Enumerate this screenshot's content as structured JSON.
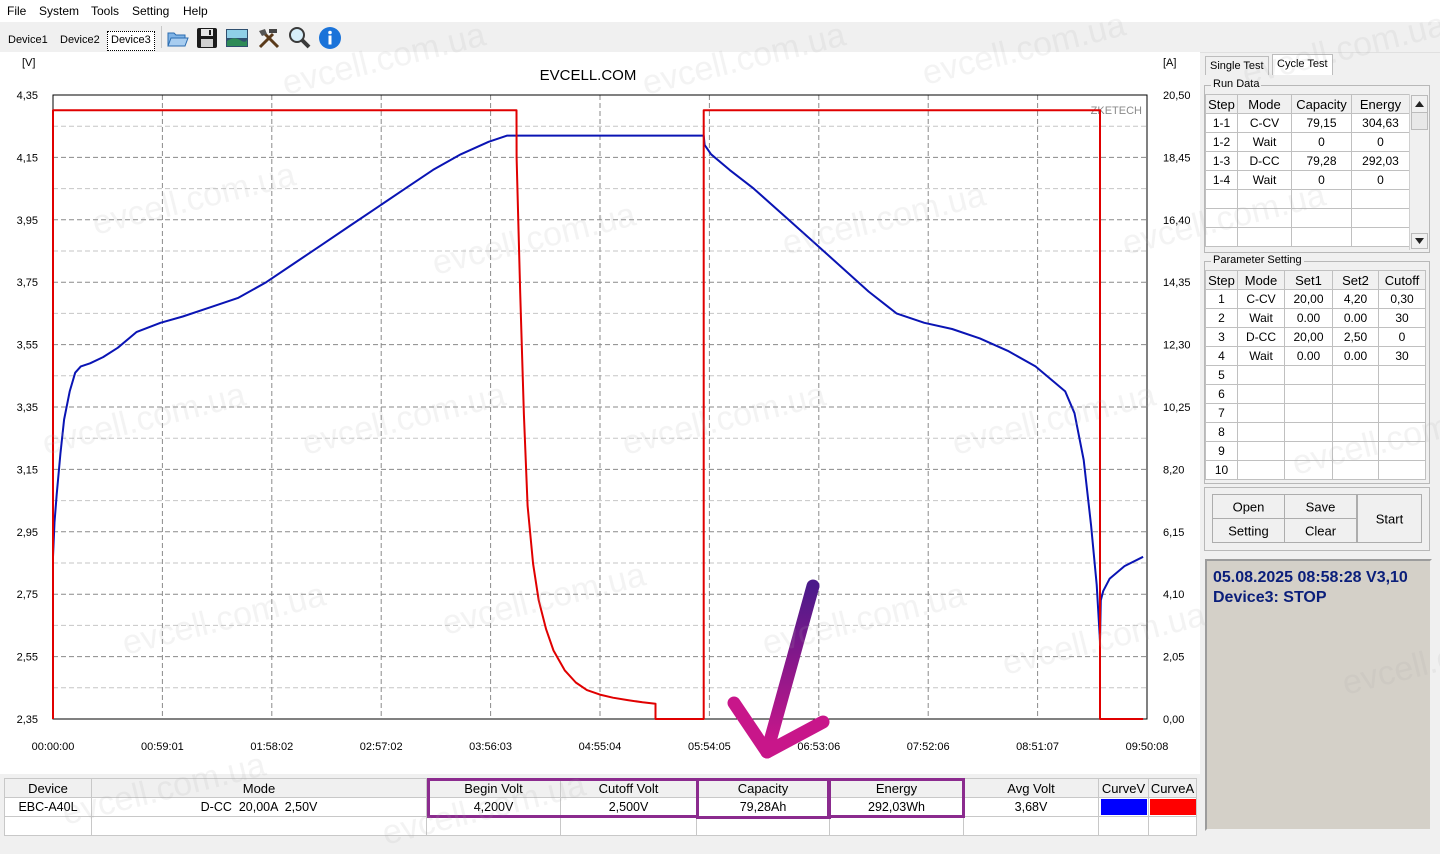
{
  "menu": [
    "File",
    "System",
    "Tools",
    "Setting",
    "Help"
  ],
  "toolbar": {
    "devices": [
      "Device1",
      "Device2",
      "Device3"
    ],
    "active_device": "Device3",
    "icons": [
      "open-folder-icon",
      "save-icon",
      "chart-image-icon",
      "tools-icon",
      "magnifier-icon",
      "info-icon"
    ]
  },
  "chart_data": {
    "type": "line",
    "title": "EVCELL.COM",
    "watermark": "ZKETECH",
    "y_left_unit": "[V]",
    "y_right_unit": "[A]",
    "y_left_ticks": [
      "4,35",
      "4,15",
      "3,95",
      "3,75",
      "3,55",
      "3,35",
      "3,15",
      "2,95",
      "2,75",
      "2,55",
      "2,35"
    ],
    "y_right_ticks": [
      "20,50",
      "18,45",
      "16,40",
      "14,35",
      "12,30",
      "10,25",
      "8,20",
      "6,15",
      "4,10",
      "2,05",
      "0,00"
    ],
    "x_ticks": [
      "00:00:00",
      "00:59:01",
      "01:58:02",
      "02:57:02",
      "03:56:03",
      "04:55:04",
      "05:54:05",
      "06:53:06",
      "07:52:06",
      "08:51:07",
      "09:50:08"
    ],
    "ylim_left": [
      2.35,
      4.35
    ],
    "ylim_right": [
      0,
      20.5
    ],
    "x_range_minutes": [
      0,
      590.13
    ],
    "grid": true,
    "series": [
      {
        "name": "CurveV",
        "axis": "left",
        "color": "#0a14b4",
        "x": [
          0,
          0.8,
          2,
          4,
          6,
          9,
          12,
          15,
          20,
          27,
          35,
          45,
          58,
          70,
          85,
          100,
          115,
          130,
          145,
          160,
          175,
          190,
          205,
          220,
          235,
          245,
          250,
          251,
          275,
          300,
          325,
          351,
          351.5,
          355,
          365,
          378,
          395,
          410,
          425,
          440,
          455,
          470,
          485,
          500,
          515,
          530,
          540,
          546,
          551,
          556,
          560,
          563,
          564.8,
          565.2,
          566.5,
          570,
          578,
          588
        ],
        "y": [
          2.87,
          2.98,
          3.07,
          3.2,
          3.31,
          3.4,
          3.46,
          3.48,
          3.49,
          3.51,
          3.54,
          3.59,
          3.62,
          3.64,
          3.67,
          3.7,
          3.75,
          3.81,
          3.87,
          3.93,
          3.99,
          4.05,
          4.11,
          4.16,
          4.2,
          4.22,
          4.22,
          4.22,
          4.22,
          4.22,
          4.22,
          4.22,
          4.19,
          4.16,
          4.11,
          4.05,
          3.96,
          3.88,
          3.8,
          3.72,
          3.65,
          3.62,
          3.6,
          3.57,
          3.53,
          3.48,
          3.43,
          3.4,
          3.33,
          3.18,
          2.97,
          2.78,
          2.6,
          2.73,
          2.76,
          2.8,
          2.84,
          2.87
        ]
      },
      {
        "name": "CurveA",
        "axis": "right",
        "color": "#e00000",
        "x": [
          0,
          0,
          250,
          250.1,
          252,
          254,
          256,
          259,
          262,
          266,
          270,
          276,
          282,
          288,
          295,
          302,
          310,
          318,
          325,
          325,
          351,
          351,
          564.8,
          564.8,
          588
        ],
        "y": [
          0,
          20.0,
          20.0,
          18.45,
          14.0,
          10.0,
          7.0,
          5.1,
          3.9,
          2.95,
          2.25,
          1.6,
          1.2,
          0.95,
          0.8,
          0.7,
          0.62,
          0.55,
          0.5,
          0,
          0,
          20.0,
          20.0,
          0,
          0
        ]
      }
    ]
  },
  "right_panel": {
    "tabs": [
      "Single Test",
      "Cycle Test"
    ],
    "active_tab": "Cycle Test",
    "run_data": {
      "title": "Run Data",
      "headers": [
        "Step",
        "Mode",
        "Capacity",
        "Energy"
      ],
      "rows": [
        [
          "1-1",
          "C-CV",
          "79,15",
          "304,63"
        ],
        [
          "1-2",
          "Wait",
          "0",
          "0"
        ],
        [
          "1-3",
          "D-CC",
          "79,28",
          "292,03"
        ],
        [
          "1-4",
          "Wait",
          "0",
          "0"
        ]
      ]
    },
    "parameter_setting": {
      "title": "Parameter Setting",
      "headers": [
        "Step",
        "Mode",
        "Set1",
        "Set2",
        "Cutoff"
      ],
      "rows": [
        [
          "1",
          "C-CV",
          "20,00",
          "4,20",
          "0,30"
        ],
        [
          "2",
          "Wait",
          "0.00",
          "0.00",
          "30"
        ],
        [
          "3",
          "D-CC",
          "20,00",
          "2,50",
          "0"
        ],
        [
          "4",
          "Wait",
          "0.00",
          "0.00",
          "30"
        ],
        [
          "5",
          "",
          "",
          "",
          ""
        ],
        [
          "6",
          "",
          "",
          "",
          ""
        ],
        [
          "7",
          "",
          "",
          "",
          ""
        ],
        [
          "8",
          "",
          "",
          "",
          ""
        ],
        [
          "9",
          "",
          "",
          "",
          ""
        ],
        [
          "10",
          "",
          "",
          "",
          ""
        ]
      ]
    },
    "buttons": {
      "open": "Open",
      "save": "Save",
      "setting": "Setting",
      "clear": "Clear",
      "start": "Start"
    },
    "status": {
      "line1": "05.08.2025 08:58:28  V3,10",
      "line2": "Device3: STOP"
    }
  },
  "bottom_table": {
    "headers": [
      "Device",
      "Mode",
      "Begin Volt",
      "Cutoff Volt",
      "Capacity",
      "Energy",
      "Avg Volt",
      "CurveV",
      "CurveA"
    ],
    "values": [
      "EBC-A40L",
      "D-CC  20,00A  2,50V",
      "4,200V",
      "2,500V",
      "79,28Ah",
      "292,03Wh",
      "3,68V",
      "",
      ""
    ],
    "curve_colors": {
      "v": "#0000ff",
      "a": "#ff0000"
    }
  },
  "watermark_text": "evcell.com.ua",
  "annotation": {
    "highlight_color": "#8b2b8e",
    "arrow_color": "#a0168a"
  }
}
